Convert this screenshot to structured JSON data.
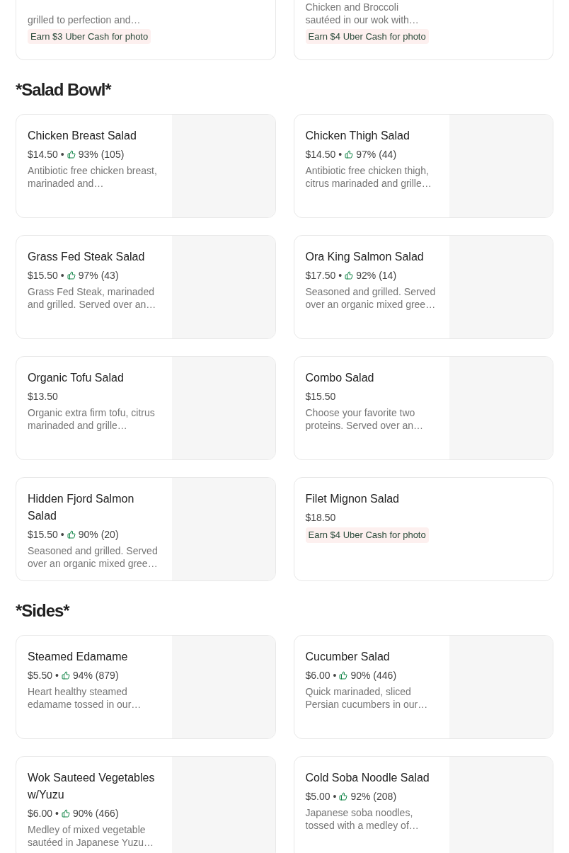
{
  "cut_off_items": [
    {
      "description": "grilled to perfection and…",
      "promo": "Earn $3 Uber Cash for photo"
    },
    {
      "description": "Chicken and Broccoli sautéed in our wok with…",
      "promo": "Earn $4 Uber Cash for photo"
    }
  ],
  "sections": [
    {
      "title": "*Salad Bowl*",
      "items": [
        {
          "name": "Chicken Breast Salad",
          "price": "$14.50",
          "separator": "•",
          "rating": "93% (105)",
          "description": "Antibiotic free chicken breast, marinaded and…",
          "image": true
        },
        {
          "name": "Chicken Thigh Salad",
          "price": "$14.50",
          "separator": "•",
          "rating": "97% (44)",
          "description": "Antibiotic free chicken thigh, citrus marinaded and grille…",
          "image": true
        },
        {
          "name": "Grass Fed Steak Salad",
          "price": "$15.50",
          "separator": "•",
          "rating": "97% (43)",
          "description": "Grass Fed Steak, marinaded and grilled. Served over an…",
          "image": true
        },
        {
          "name": "Ora King Salmon Salad",
          "price": "$17.50",
          "separator": "•",
          "rating": "92% (14)",
          "description": "Seasoned and grilled. Served over an organic mixed gree…",
          "image": true
        },
        {
          "name": "Organic Tofu Salad",
          "price": "$13.50",
          "description": "Organic extra firm tofu, citrus marinaded and grille…",
          "image": true
        },
        {
          "name": "Combo Salad",
          "price": "$15.50",
          "description": "Choose your favorite two proteins. Served over an…",
          "image": true
        },
        {
          "name": "Hidden Fjord Salmon Salad",
          "price": "$15.50",
          "separator": "•",
          "rating": "90% (20)",
          "description": "Seasoned and grilled. Served over an organic mixed gree…",
          "image": true
        },
        {
          "name": "Filet Mignon Salad",
          "price": "$18.50",
          "promo": "Earn $4 Uber Cash for photo",
          "image": false
        }
      ]
    },
    {
      "title": "*Sides*",
      "items": [
        {
          "name": "Steamed Edamame",
          "price": "$5.50",
          "separator": "•",
          "rating": "94% (879)",
          "description": "Heart healthy steamed edamame tossed in our…",
          "image": true
        },
        {
          "name": "Cucumber Salad",
          "price": "$6.00",
          "separator": "•",
          "rating": "90% (446)",
          "description": "Quick marinaded, sliced Persian cucumbers in our…",
          "image": true
        },
        {
          "name": "Wok Sauteed Vegetables w/Yuzu",
          "price": "$6.00",
          "separator": "•",
          "rating": "90% (466)",
          "description": "Medley of mixed vegetable sautéed in Japanese Yuzu…",
          "image": true
        },
        {
          "name": "Cold Soba Noodle Salad",
          "price": "$5.00",
          "separator": "•",
          "rating": "92% (208)",
          "description": "Japanese soba noodles, tossed with a medley of…",
          "image": true
        }
      ]
    }
  ]
}
